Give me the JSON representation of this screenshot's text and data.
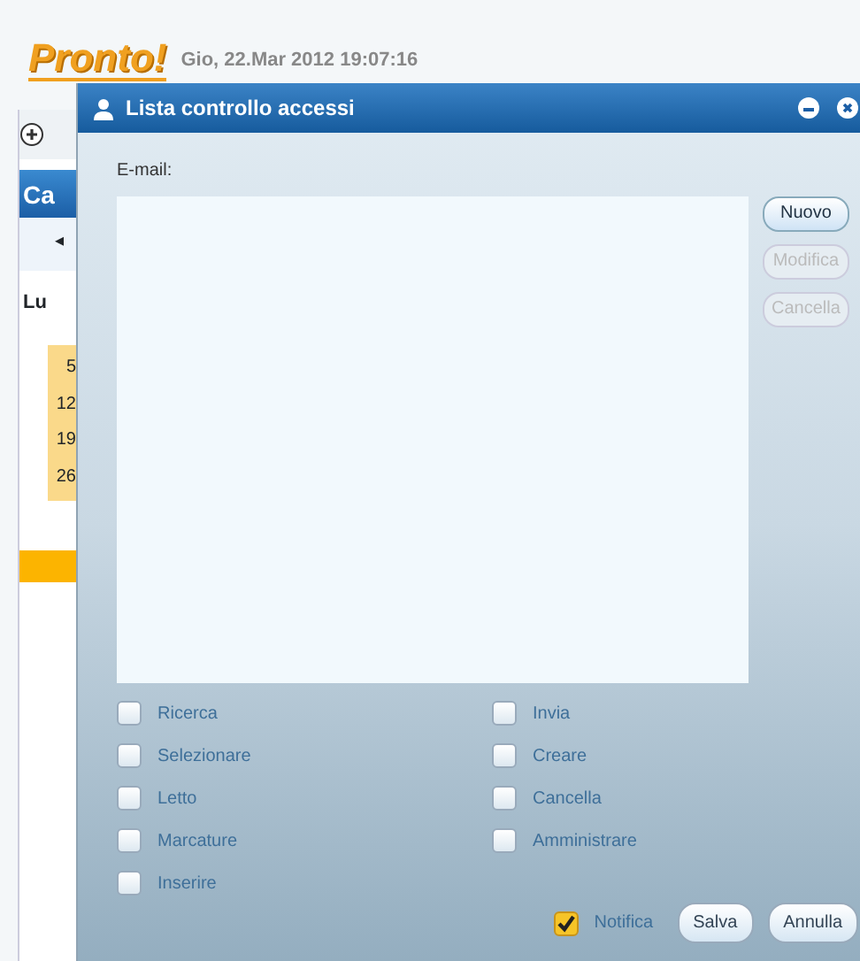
{
  "app": {
    "logo": "Pronto!",
    "datetime": "Gio, 22.Mar 2012 19:07:16",
    "panel_title": "Ca",
    "nav_arrow": "◂",
    "day_header": "Lu",
    "dates": [
      "5",
      "12",
      "19",
      "26"
    ]
  },
  "dialog": {
    "title": "Lista controllo accessi",
    "email_label": "E-mail:",
    "side_buttons": [
      {
        "label": "Nuovo",
        "disabled": false
      },
      {
        "label": "Modifica",
        "disabled": true
      },
      {
        "label": "Cancella",
        "disabled": true
      }
    ],
    "permissions": [
      {
        "label": "Ricerca",
        "checked": false
      },
      {
        "label": "Invia",
        "checked": false
      },
      {
        "label": "Selezionare",
        "checked": false
      },
      {
        "label": "Creare",
        "checked": false
      },
      {
        "label": "Letto",
        "checked": false
      },
      {
        "label": "Cancella",
        "checked": false
      },
      {
        "label": "Marcature",
        "checked": false
      },
      {
        "label": "Amministrare",
        "checked": false
      },
      {
        "label": "Inserire",
        "checked": false
      }
    ],
    "notify": {
      "label": "Notifica",
      "checked": true
    },
    "buttons": [
      "Salva",
      "Annulla"
    ]
  }
}
